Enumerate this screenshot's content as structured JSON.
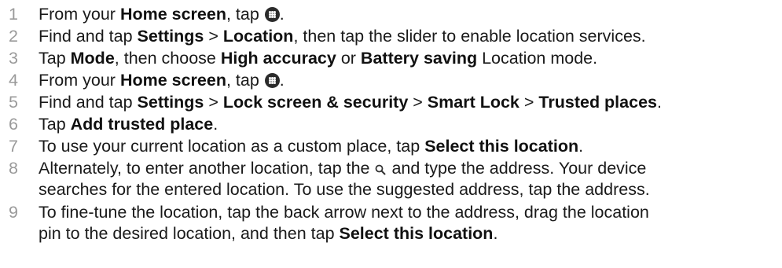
{
  "steps": [
    {
      "num": "1",
      "segments": [
        {
          "t": "From your "
        },
        {
          "t": "Home screen",
          "b": true
        },
        {
          "t": ", tap "
        },
        {
          "icon": "apps-grid-icon"
        },
        {
          "t": "."
        }
      ]
    },
    {
      "num": "2",
      "segments": [
        {
          "t": "Find and tap "
        },
        {
          "t": "Settings",
          "b": true
        },
        {
          "t": " > "
        },
        {
          "t": "Location",
          "b": true
        },
        {
          "t": ", then tap the slider to enable location services."
        }
      ]
    },
    {
      "num": "3",
      "segments": [
        {
          "t": "Tap "
        },
        {
          "t": "Mode",
          "b": true
        },
        {
          "t": ", then choose "
        },
        {
          "t": "High accuracy",
          "b": true
        },
        {
          "t": " or "
        },
        {
          "t": "Battery saving",
          "b": true
        },
        {
          "t": " Location mode."
        }
      ]
    },
    {
      "num": "4",
      "segments": [
        {
          "t": "From your "
        },
        {
          "t": "Home screen",
          "b": true
        },
        {
          "t": ", tap "
        },
        {
          "icon": "apps-grid-icon"
        },
        {
          "t": "."
        }
      ]
    },
    {
      "num": "5",
      "segments": [
        {
          "t": "Find and tap "
        },
        {
          "t": "Settings",
          "b": true
        },
        {
          "t": " > "
        },
        {
          "t": "Lock screen & security",
          "b": true
        },
        {
          "t": " > "
        },
        {
          "t": "Smart Lock",
          "b": true
        },
        {
          "t": " > "
        },
        {
          "t": "Trusted places",
          "b": true
        },
        {
          "t": "."
        }
      ]
    },
    {
      "num": "6",
      "segments": [
        {
          "t": "Tap "
        },
        {
          "t": "Add trusted place",
          "b": true
        },
        {
          "t": "."
        }
      ]
    },
    {
      "num": "7",
      "segments": [
        {
          "t": "To use your current location as a custom place, tap "
        },
        {
          "t": "Select this location",
          "b": true
        },
        {
          "t": "."
        }
      ]
    },
    {
      "num": "8",
      "segments": [
        {
          "t": "Alternately, to enter another location, tap the "
        },
        {
          "icon": "search-icon"
        },
        {
          "t": " and type the address. Your device"
        },
        {
          "br": true
        },
        {
          "t": "searches for the entered location. To use the suggested address, tap the address."
        }
      ]
    },
    {
      "num": "9",
      "segments": [
        {
          "t": "To fine-tune the location, tap the back arrow next to the address, drag the location"
        },
        {
          "br": true
        },
        {
          "t": "pin to the desired location, and then tap "
        },
        {
          "t": "Select this location",
          "b": true
        },
        {
          "t": "."
        }
      ]
    }
  ]
}
